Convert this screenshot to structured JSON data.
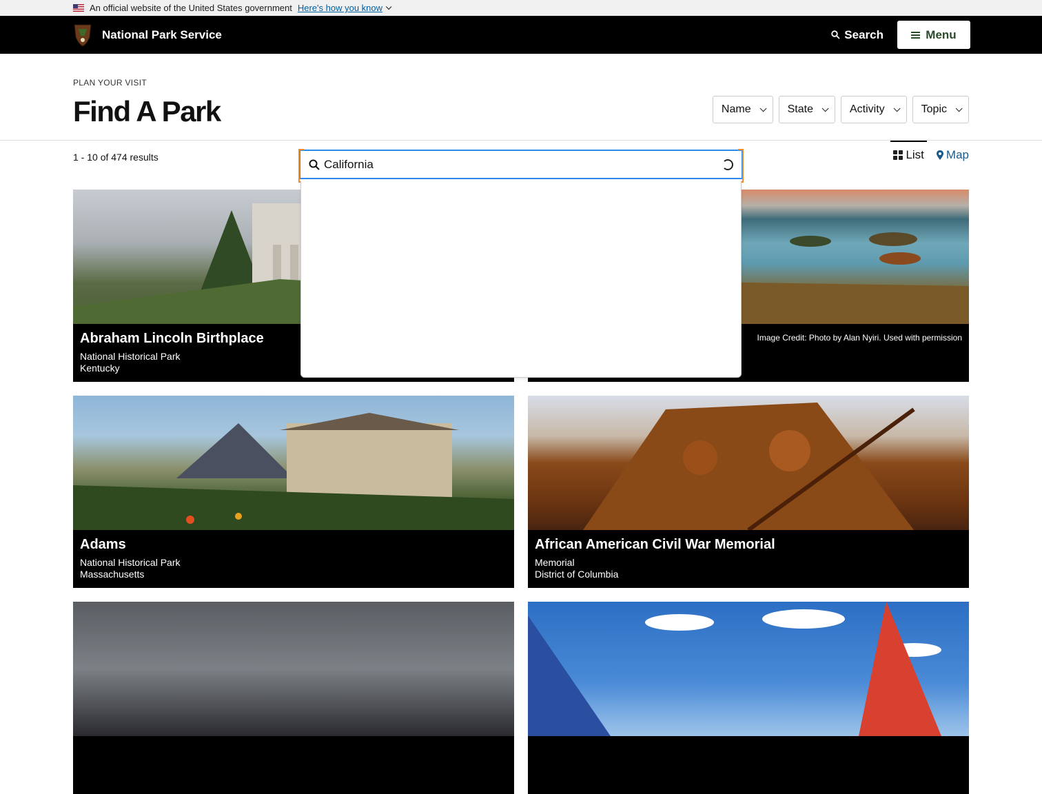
{
  "gov_banner": {
    "text": "An official website of the United States government",
    "link": "Here's how you know"
  },
  "header": {
    "brand": "National Park Service",
    "search_label": "Search",
    "menu_label": "Menu"
  },
  "page": {
    "eyebrow": "PLAN YOUR VISIT",
    "title": "Find A Park"
  },
  "filters": [
    "Name",
    "State",
    "Activity",
    "Topic"
  ],
  "results": {
    "count_text": "1 - 10 of 474 results",
    "list_label": "List",
    "map_label": "Map"
  },
  "search": {
    "value": "California"
  },
  "cards": [
    {
      "title": "Abraham Lincoln Birthplace",
      "type": "National Historical Park",
      "state": "Kentucky"
    },
    {
      "title": "",
      "type": "",
      "state": "",
      "credit": "Image Credit: Photo by Alan Nyiri. Used with permission"
    },
    {
      "title": "Adams",
      "type": "National Historical Park",
      "state": "Massachusetts"
    },
    {
      "title": "African American Civil War Memorial",
      "type": "Memorial",
      "state": "District of Columbia"
    }
  ],
  "colors": {
    "header_bg": "#000000",
    "accent_green": "#2b4a2c",
    "link_blue": "#1a5a8a",
    "focus_blue": "#2b8aeb",
    "focus_orange": "#f28c28"
  }
}
